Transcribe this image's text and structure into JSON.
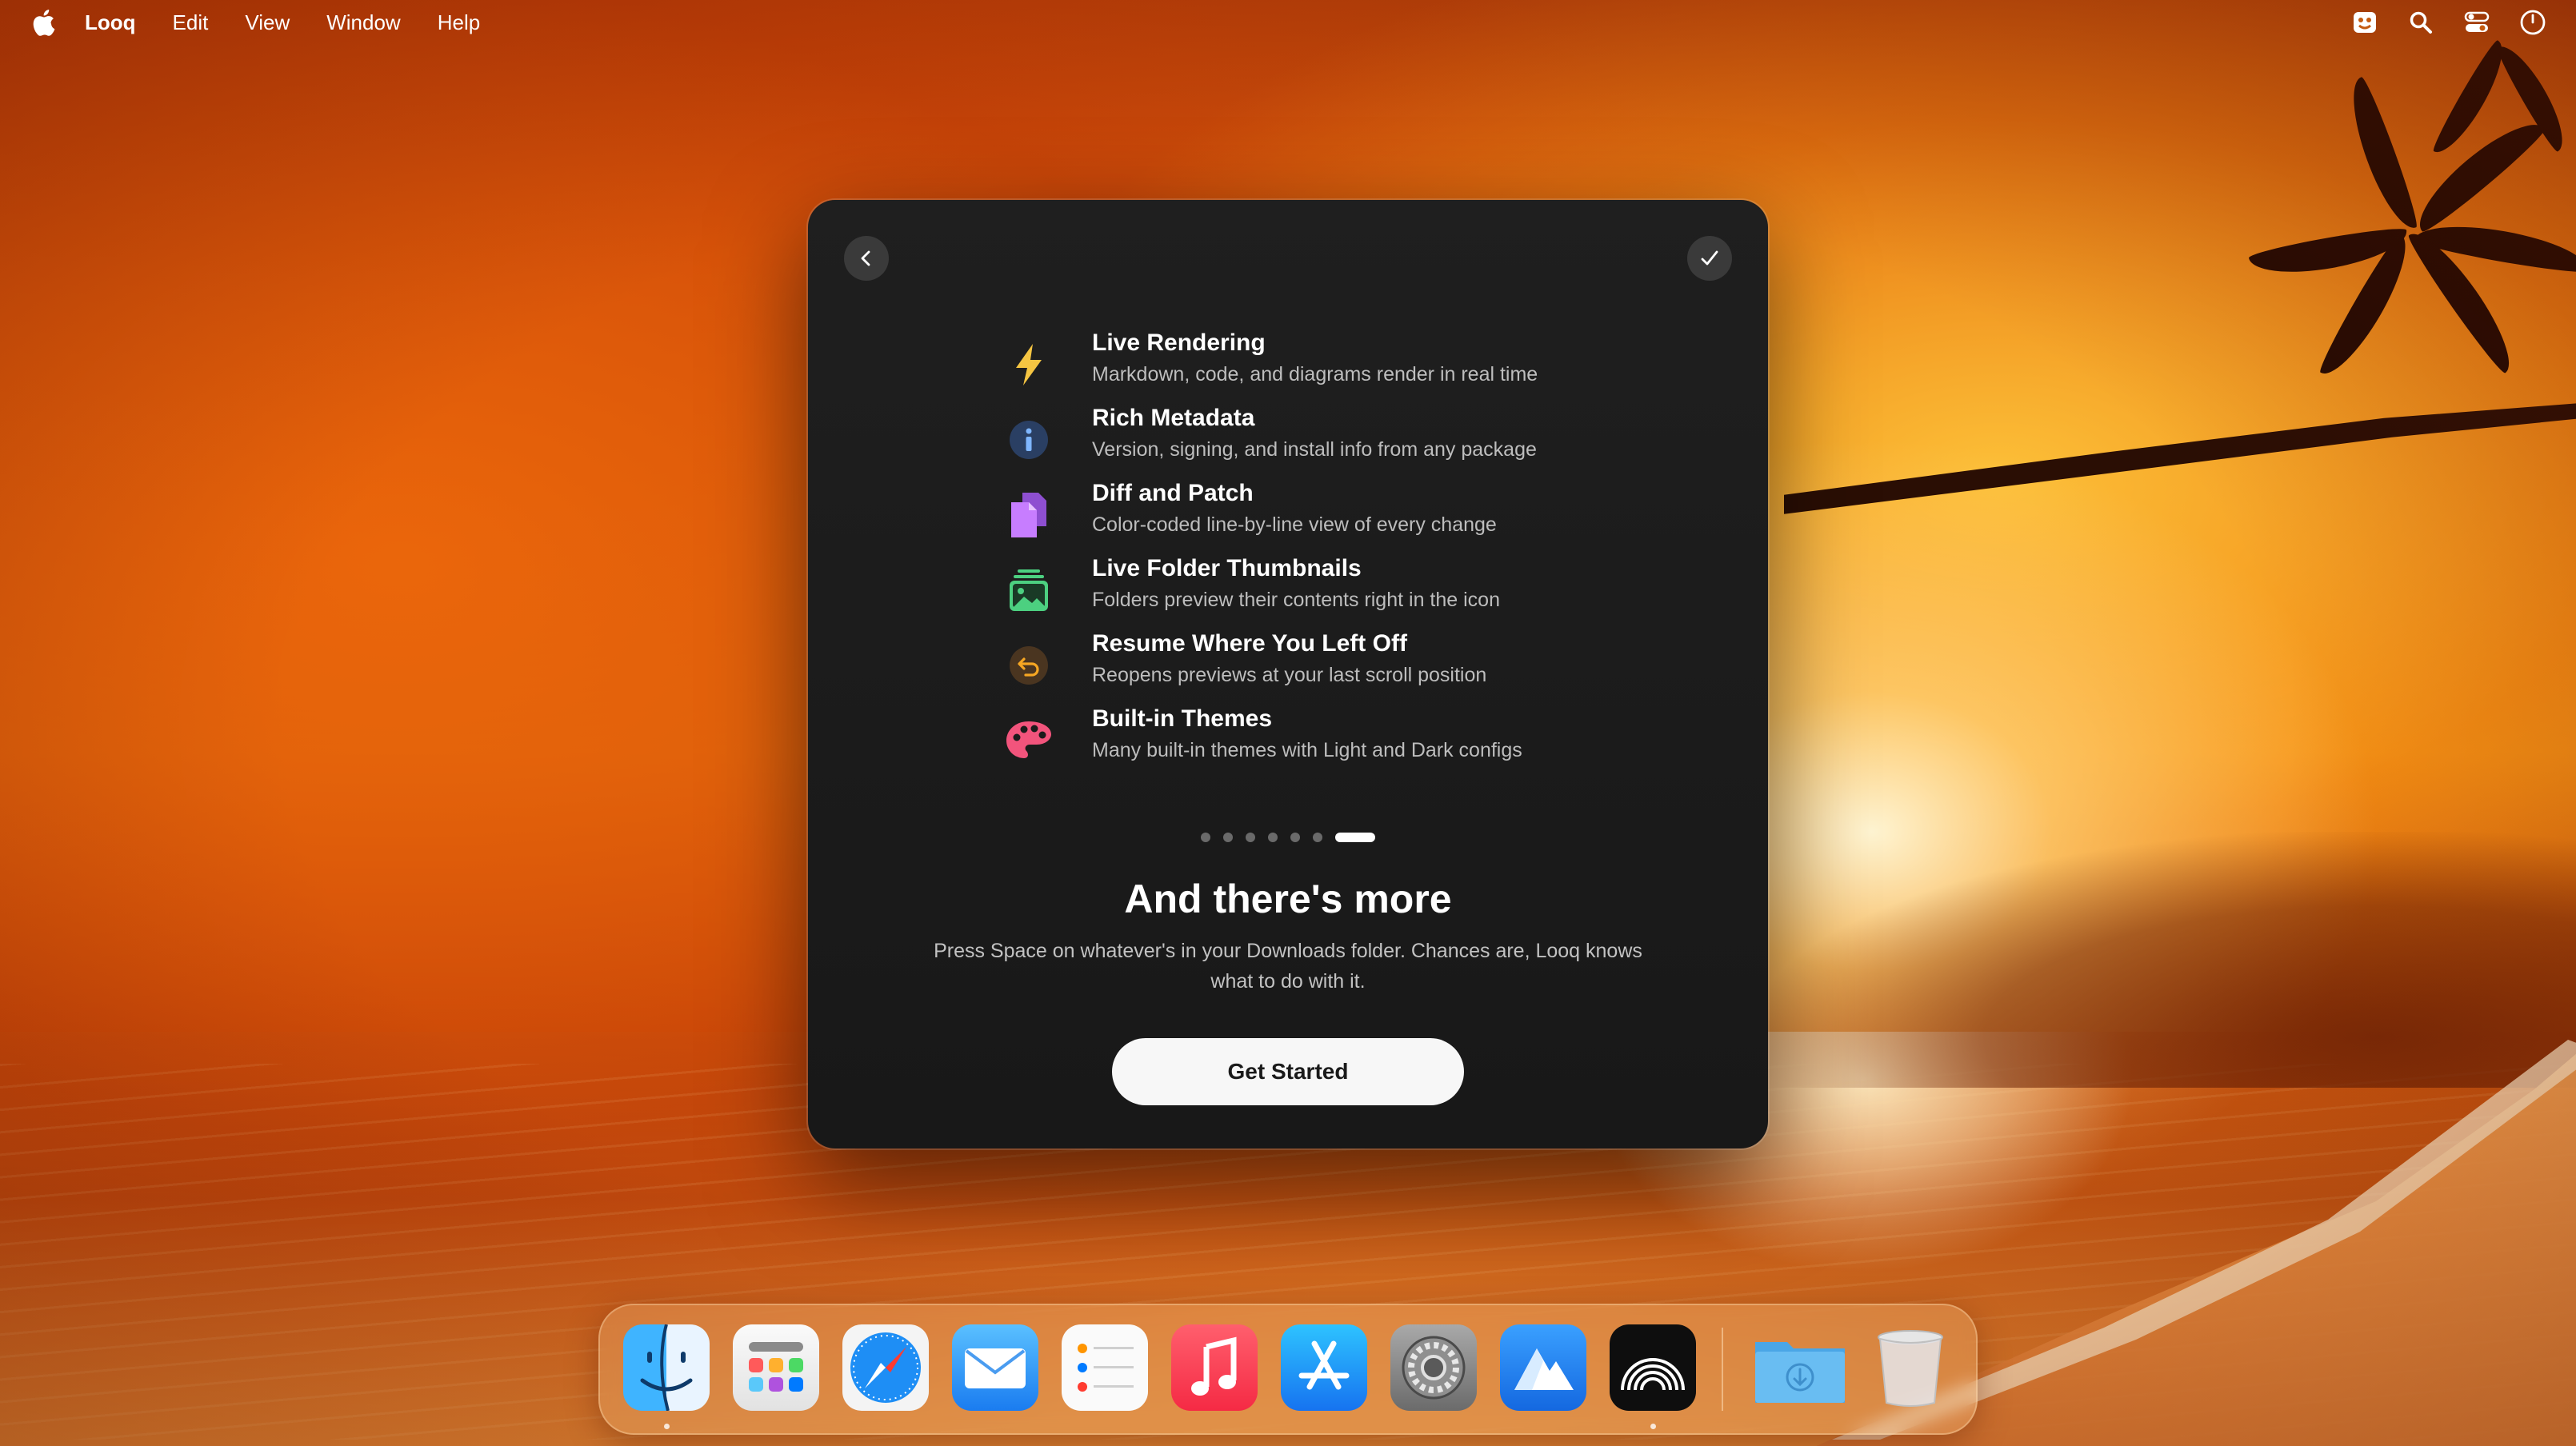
{
  "menubar": {
    "app_name": "Looq",
    "items": [
      "Edit",
      "View",
      "Window",
      "Help"
    ],
    "right_icons": [
      "app-status-icon",
      "search-icon",
      "control-center-icon",
      "clock-icon"
    ]
  },
  "window": {
    "back_icon": "chevron-left-icon",
    "done_icon": "checkmark-icon",
    "features": [
      {
        "icon": "lightning-bolt-icon",
        "color": "#F5C542",
        "title": "Live Rendering",
        "desc": "Markdown, code, and diagrams render in real time"
      },
      {
        "icon": "info-circle-icon",
        "color": "#4A90E2",
        "title": "Rich Metadata",
        "desc": "Version, signing, and install info from any package"
      },
      {
        "icon": "documents-icon",
        "color": "#C77DFF",
        "title": "Diff and Patch",
        "desc": "Color-coded line-by-line view of every change"
      },
      {
        "icon": "photo-stack-icon",
        "color": "#4CD080",
        "title": "Live Folder Thumbnails",
        "desc": "Folders preview their contents right in the icon"
      },
      {
        "icon": "return-arrow-icon",
        "color": "#F5A623",
        "title": "Resume Where You Left Off",
        "desc": "Reopens previews at your last scroll position"
      },
      {
        "icon": "palette-icon",
        "color": "#F2547C",
        "title": "Built-in Themes",
        "desc": "Many built-in themes with Light and Dark configs"
      }
    ],
    "pager": {
      "total": 7,
      "active": 7
    },
    "headline": "And there's more",
    "subline": "Press Space on whatever's in your Downloads folder. Chances are, Looq knows what to do with it.",
    "cta_label": "Get Started"
  },
  "dock": {
    "apps": [
      "finder-icon",
      "launchpad-icon",
      "safari-icon",
      "mail-icon",
      "reminders-icon",
      "music-icon",
      "app-store-icon",
      "system-settings-icon",
      "mountain-app-icon",
      "rainbow-app-icon"
    ],
    "running": [
      "finder-icon",
      "rainbow-app-icon"
    ],
    "right": [
      "downloads-folder-icon",
      "trash-icon"
    ]
  }
}
